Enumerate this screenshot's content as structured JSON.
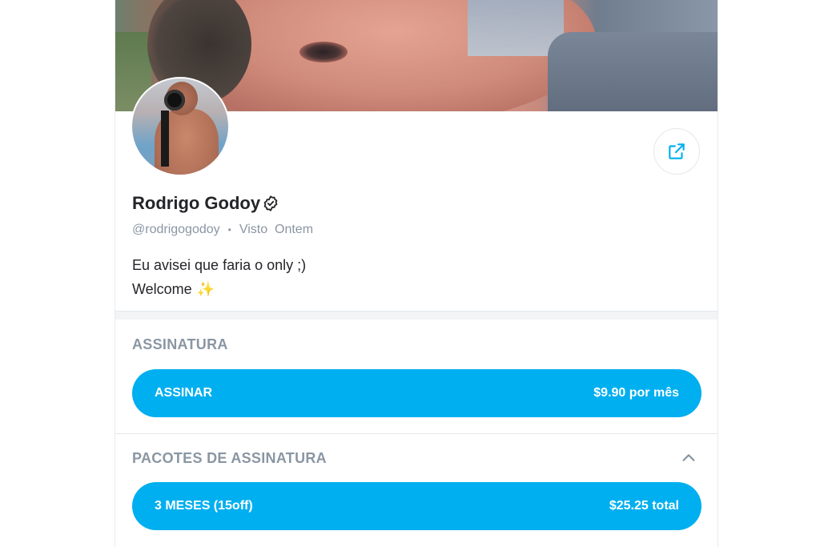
{
  "profile": {
    "name": "Rodrigo Godoy",
    "handle": "@rodrigogodoy",
    "separator": "•",
    "last_seen": "Visto  Ontem",
    "bio_line1": "Eu avisei que faria o only ;)",
    "bio_line2": "Welcome",
    "bio_emoji": "✨"
  },
  "subscription": {
    "section_title": "ASSINATURA",
    "button_label": "ASSINAR",
    "button_price": "$9.90 por mês"
  },
  "bundles": {
    "section_title": "PACOTES DE ASSINATURA",
    "items": [
      {
        "label": "3 MESES (15off)",
        "price": "$25.25 total"
      }
    ]
  },
  "icons": {
    "share": "share-icon",
    "verified": "verified-badge-icon",
    "collapse": "chevron-up-icon"
  },
  "colors": {
    "accent": "#00aff0",
    "muted_text": "#8a96a3",
    "primary_text": "#242529"
  }
}
